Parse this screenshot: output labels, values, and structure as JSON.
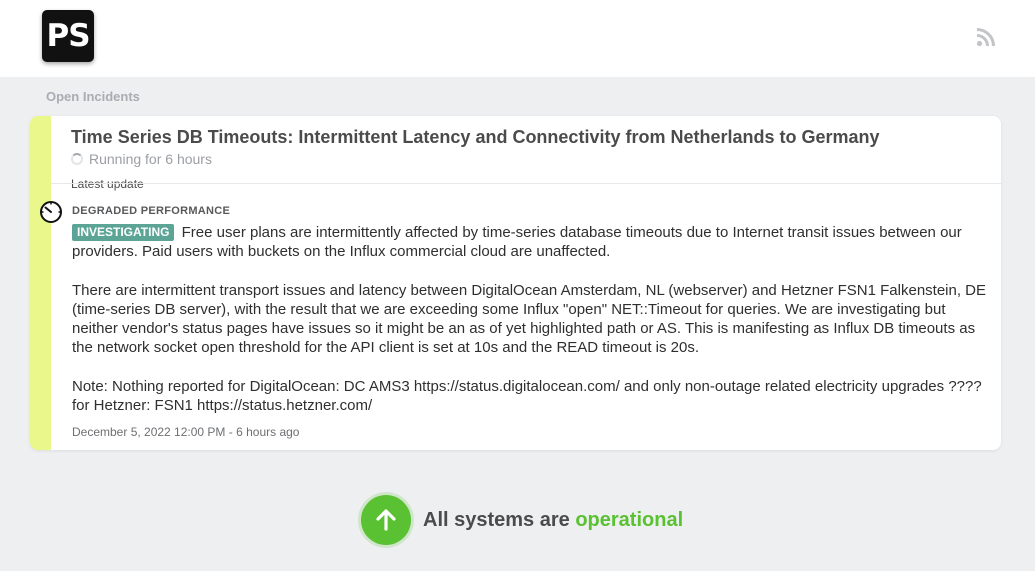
{
  "header": {
    "logo_text": "PS",
    "rss_icon": "rss-icon"
  },
  "open_incidents": {
    "label": "Open Incidents",
    "incident": {
      "title": "Time Series DB Timeouts: Intermittent Latency and Connectivity from Netherlands to Germany",
      "running": "Running for 6 hours",
      "latest_label": "Latest update",
      "impact_color": "#e9f78b",
      "update": {
        "status": "DEGRADED PERFORMANCE",
        "badge": "INVESTIGATING",
        "badge_color": "#5ca496",
        "paragraph1": "Free user plans are intermittently affected by time-series database timeouts due to Internet transit issues between our providers. Paid users with buckets on the Influx commercial cloud are unaffected.",
        "paragraph2": "There are intermittent transport issues and latency between DigitalOcean Amsterdam, NL (webserver) and Hetzner FSN1 Falkenstein, DE  (time-series DB server), with the result that we are exceeding some Influx \"open\" NET::Timeout for queries. We are investigating but neither vendor's status pages have issues so it might be an as of yet highlighted path or AS. This is manifesting as Influx DB timeouts as the network socket open threshold for the API client is set at 10s and the READ timeout is 20s.",
        "paragraph3": "Note: Nothing reported for DigitalOcean: DC AMS3 https://status.digitalocean.com/ and only non-outage related electricity upgrades ???? for Hetzner: FSN1 https://status.hetzner.com/",
        "timestamp": "December 5, 2022 12:00 PM - 6 hours ago"
      }
    }
  },
  "system_status": {
    "prefix": "All systems are",
    "state": "operational",
    "color": "#59c132",
    "icon": "arrow-up-icon"
  }
}
